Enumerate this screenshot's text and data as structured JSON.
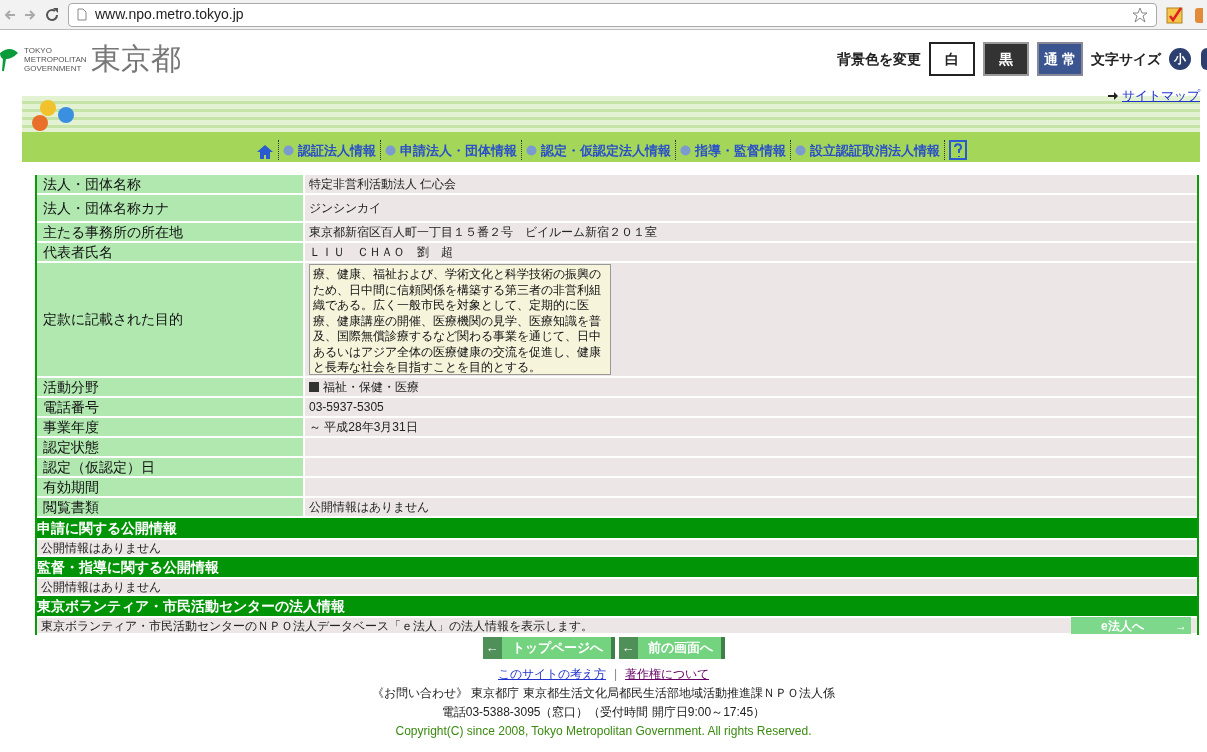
{
  "browser": {
    "url": "www.npo.metro.tokyo.jp"
  },
  "header": {
    "logo_small": [
      "TOKYO",
      "METROPOLITAN",
      "GOVERNMENT"
    ],
    "logo_main": "東京都",
    "bg_label": "背景色を変更",
    "bg_buttons": [
      {
        "label": "白",
        "kind": "white"
      },
      {
        "label": "黒",
        "kind": "black"
      },
      {
        "label": "通 常",
        "kind": "normal"
      }
    ],
    "font_label": "文字サイズ",
    "font_buttons": [
      {
        "label": "小"
      }
    ]
  },
  "sitemap": "サイトマップ",
  "nav": [
    {
      "label": "認証法人情報"
    },
    {
      "label": "申請法人・団体情報"
    },
    {
      "label": "認定・仮認定法人情報"
    },
    {
      "label": "指導・監督情報"
    },
    {
      "label": "設立認証取消法人情報"
    }
  ],
  "rows": [
    {
      "label": "法人・団体名称",
      "value": "特定非営利活動法人 仁心会",
      "kind": "text"
    },
    {
      "label": "法人・団体名称カナ",
      "value": "ジンシンカイ",
      "kind": "text"
    },
    {
      "label": "主たる事務所の所在地",
      "value": "東京都新宿区百人町一丁目１５番２号　ビイルーム新宿２０１室",
      "kind": "text"
    },
    {
      "label": "代表者氏名",
      "value": "ＬＩＵ　ＣＨＡＯ　劉　超",
      "kind": "text"
    },
    {
      "label": "定款に記載された目的",
      "value": "療、健康、福祉および、学術文化と科学技術の振興のため、日中間に信頼関係を構築する第三者の非営利組織である。広く一般市民を対象として、定期的に医療、健康講座の開催、医療機関の見学、医療知識を普及、国際無償診療するなど関わる事業を通じて、日中あるいはアジア全体の医療健康の交流を促進し、健康と長寿な社会を目指すことを目的とする。",
      "kind": "textarea"
    },
    {
      "label": "活動分野",
      "value": "福祉・保健・医療",
      "kind": "category"
    },
    {
      "label": "電話番号",
      "value": "03-5937-5305",
      "kind": "text"
    },
    {
      "label": "事業年度",
      "value": "～ 平成28年3月31日",
      "kind": "text"
    },
    {
      "label": "認定状態",
      "kind": "text"
    },
    {
      "label": "認定（仮認定）日",
      "kind": "text"
    },
    {
      "label": "有効期間",
      "kind": "text"
    },
    {
      "label": "閲覧書類",
      "value": "公開情報はありません",
      "kind": "text"
    }
  ],
  "sections": [
    {
      "title": "申請に関する公開情報",
      "text": "公開情報はありません"
    },
    {
      "title": "監督・指導に関する公開情報",
      "text": "公開情報はありません"
    },
    {
      "title": "東京ボランティア・市民活動センターの法人情報",
      "text": "東京ボランティア・市民活動センターのＮＰＯ法人データベース「ｅ法人」の法人情報を表示します。",
      "button": "e法人へ",
      "button_arrow": "→"
    }
  ],
  "nav_buttons": [
    {
      "arrow": "←",
      "label": "トップページへ"
    },
    {
      "arrow": "←",
      "label": "前の画面へ"
    }
  ],
  "footer": {
    "links": [
      "このサイトの考え方",
      "著作権について"
    ],
    "separator": "|",
    "contact": "《お問い合わせ》 東京都庁 東京都生活文化局都民生活部地域活動推進課ＮＰＯ法人係",
    "phone": "電話03-5388-3095（窓口）（受付時間 開庁日9:00～17:45）",
    "copyright": "Copyright(C) since 2008, Tokyo Metropolitan Government. All rights Reserved."
  }
}
